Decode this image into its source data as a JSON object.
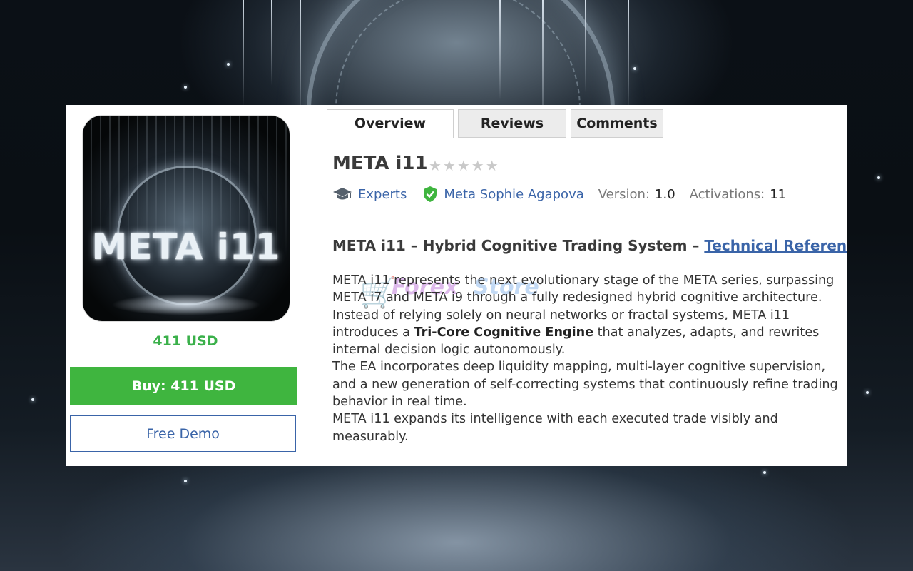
{
  "product": {
    "logo_text": "META i11",
    "price": "411 USD",
    "buy_label": "Buy: 411 USD",
    "demo_label": "Free Demo",
    "rating": 0
  },
  "tabs": [
    {
      "label": "Overview",
      "active": true
    },
    {
      "label": "Reviews",
      "active": false
    },
    {
      "label": "Comments",
      "active": false
    }
  ],
  "overview": {
    "title": "META i11",
    "stars": "★★★★★",
    "category": "Experts",
    "author": "Meta Sophie Agapova",
    "version_label": "Version:",
    "version_value": "1.0",
    "activations_label": "Activations:",
    "activations_value": "11",
    "heading": "META i11 – Hybrid Cognitive Trading System – ",
    "heading_link": "Technical Reference",
    "p1": "META i11 represents the next evolutionary stage of the META series, surpassing META i7 and META i9 through a fully redesigned hybrid cognitive architecture.",
    "p2_before": "Instead of relying solely on neural networks or fractal systems, META i11 introduces a ",
    "p2_bold": "Tri-Core Cognitive Engine",
    "p2_after": " that analyzes, adapts, and rewrites internal decision logic autonomously.",
    "p3": "The EA incorporates deep liquidity mapping, multi-layer cognitive supervision, and a new generation of self-correcting systems that continuously refine trading behavior in real time.",
    "p4": "META i11 expands its intelligence with each executed trade visibly and measurably."
  },
  "colors": {
    "accent_green": "#3fb53f",
    "link_blue": "#3a64a8",
    "price_green": "#3ab04a"
  },
  "icons": {
    "category": "graduation-cap-icon",
    "author": "verified-shield-icon"
  }
}
